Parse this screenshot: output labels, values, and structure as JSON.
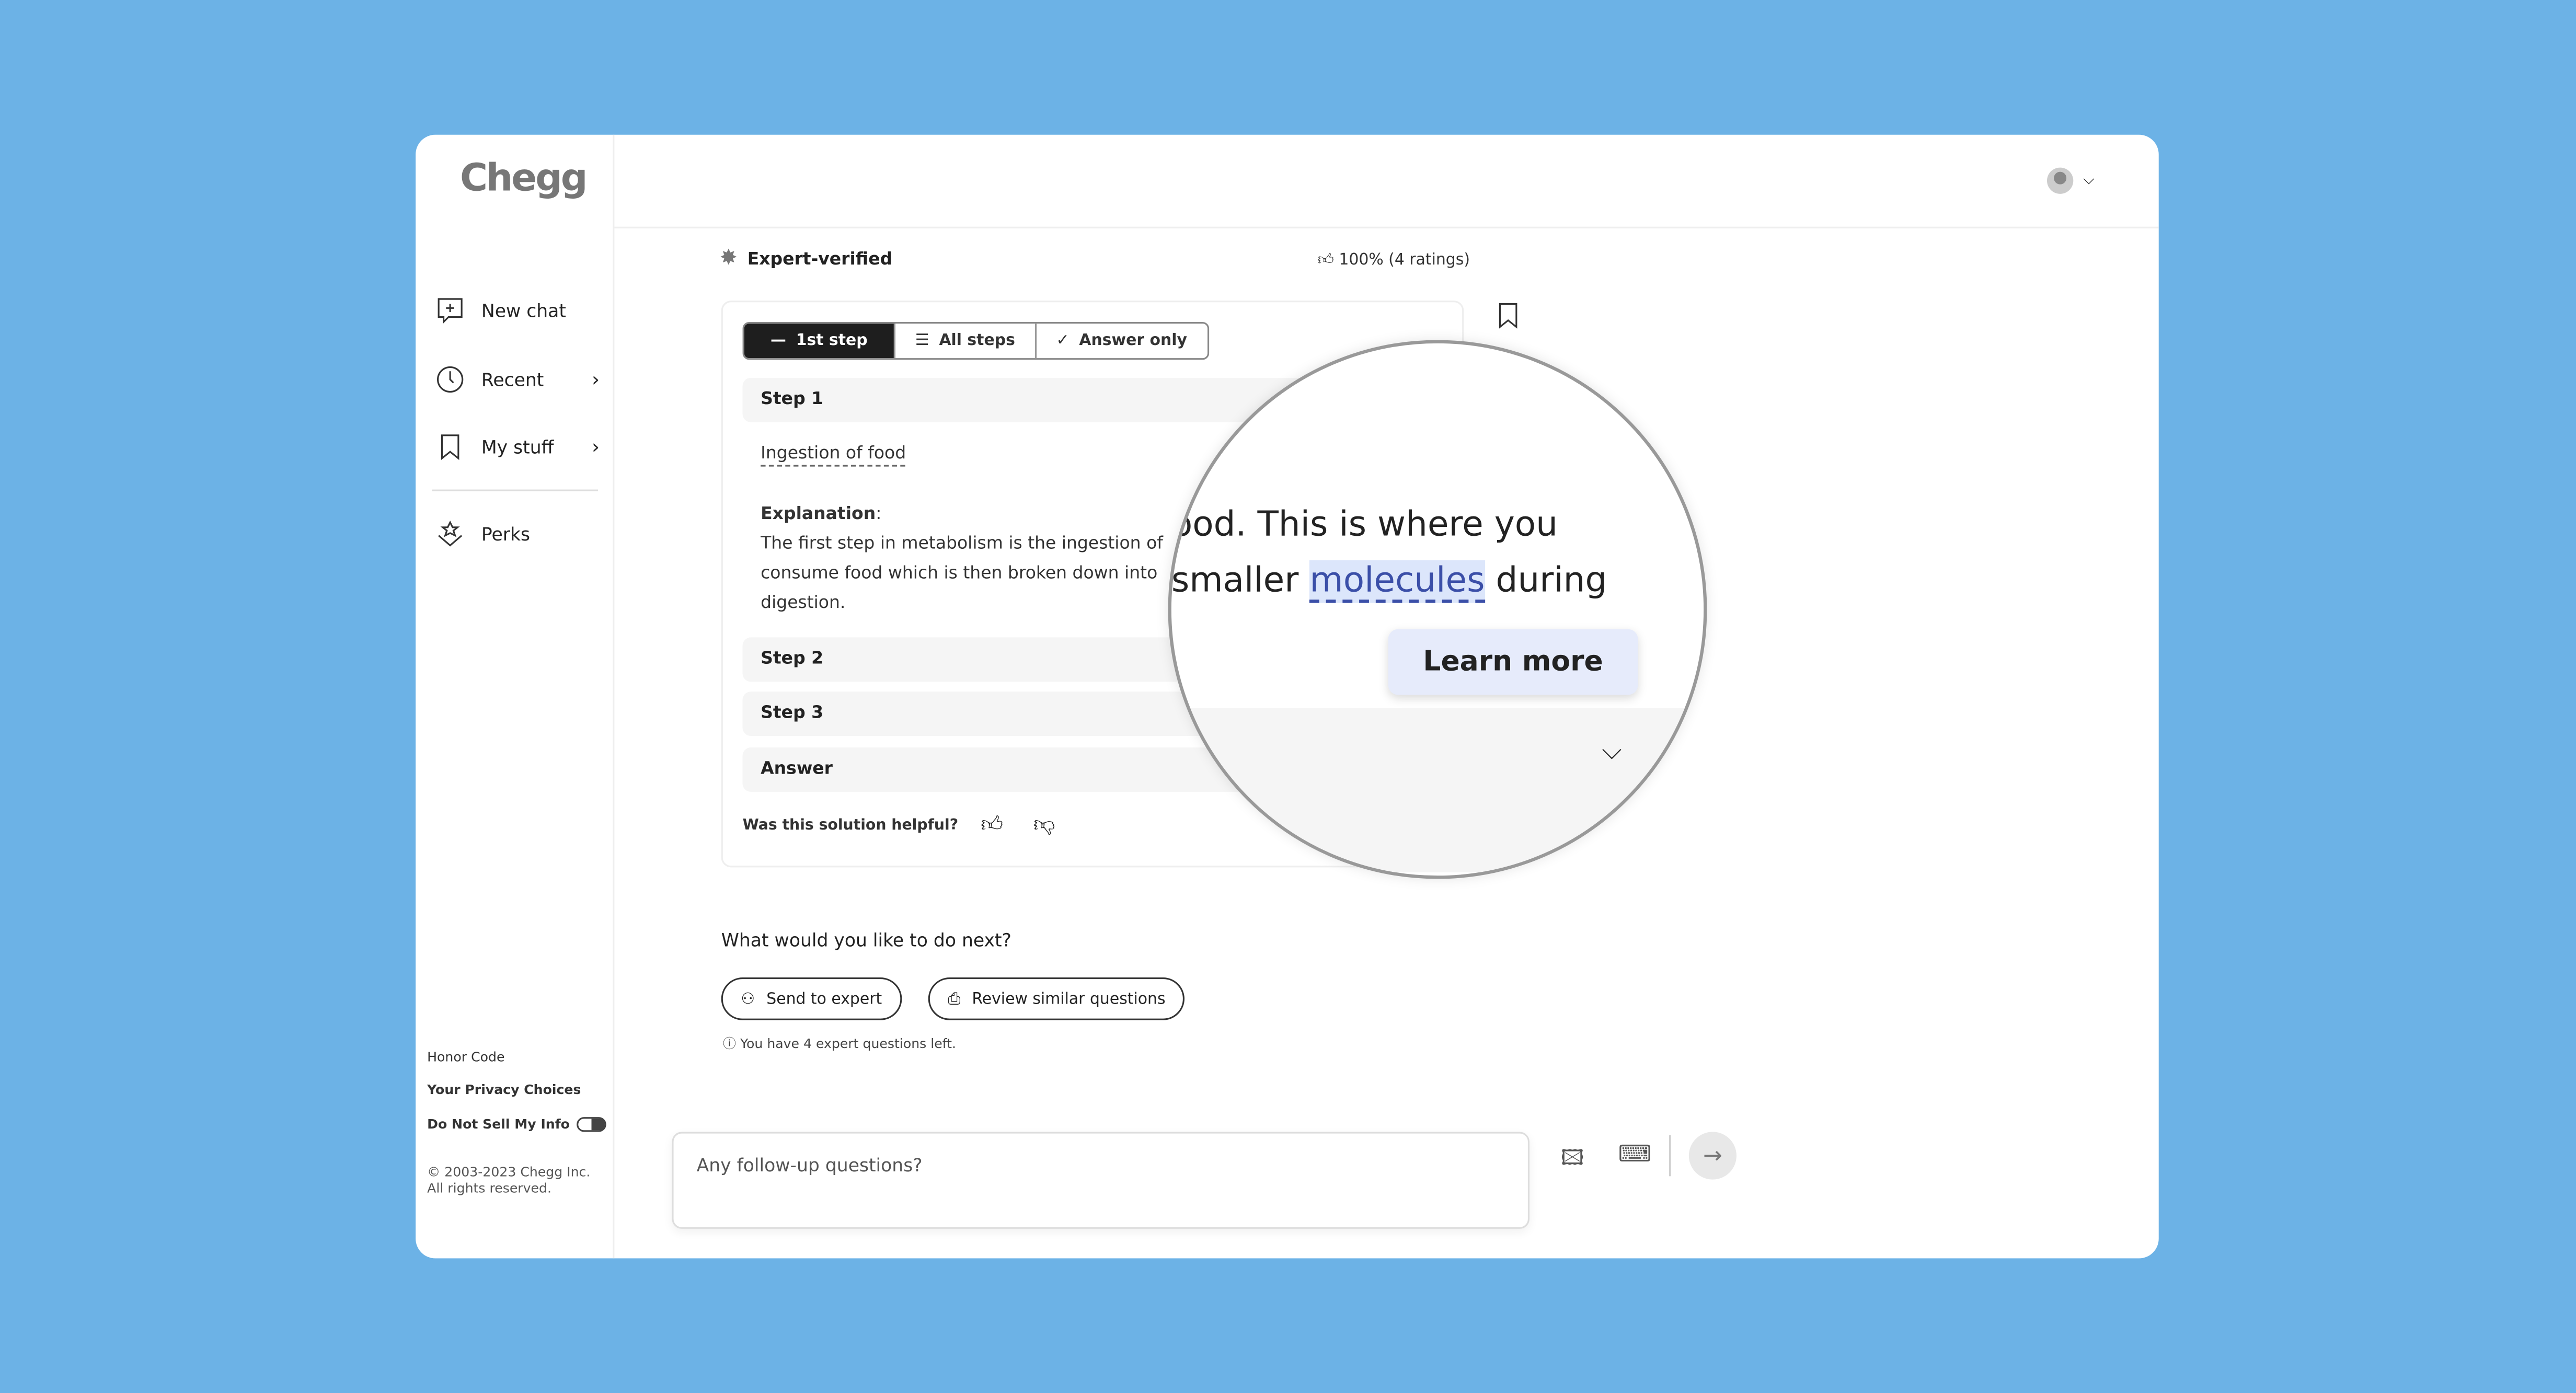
{
  "brand": {
    "logo": "Chegg"
  },
  "sidebar": {
    "items": [
      {
        "label": "New chat",
        "icon": "new-chat-icon"
      },
      {
        "label": "Recent",
        "icon": "clock-icon"
      },
      {
        "label": "My stuff",
        "icon": "bookmark-icon"
      },
      {
        "label": "Perks",
        "icon": "perks-icon"
      }
    ],
    "footer": {
      "honor": "Honor Code",
      "privacy": "Your Privacy Choices",
      "dnsmi": "Do Not Sell My Info",
      "copyright1": "© 2003-2023 Chegg Inc.",
      "copyright2": "All rights reserved."
    }
  },
  "solution": {
    "verified": "Expert-verified",
    "rating": "100% (4 ratings)",
    "tabs": [
      {
        "label": "1st step",
        "active": true
      },
      {
        "label": "All steps"
      },
      {
        "label": "Answer only"
      }
    ],
    "steps": [
      "Step 1",
      "Step 2",
      "Step 3",
      "Answer"
    ],
    "step1_title": "Ingestion of food",
    "explanation_label": "Explanation",
    "explanation_lines": [
      "The first step in metabolism is the ingestion of",
      "consume food which is then broken down into",
      "digestion."
    ],
    "helpful": "Was this solution helpful?"
  },
  "magnifier": {
    "line1": "ood. This is where you",
    "line2_pre": "smaller ",
    "line2_highlight": "molecules",
    "line2_post": " during",
    "learn_more": "Learn more",
    "highlight_color": "#dce6fb"
  },
  "next": {
    "prompt": "What would you like to do next?",
    "send_expert": "Send to expert",
    "review": "Review similar questions",
    "info": "You have 4 expert questions left."
  },
  "chat": {
    "placeholder": "Any follow-up questions?"
  },
  "colors": {
    "background": "#6cb2e6",
    "active_tab": "#1e1e1e"
  }
}
